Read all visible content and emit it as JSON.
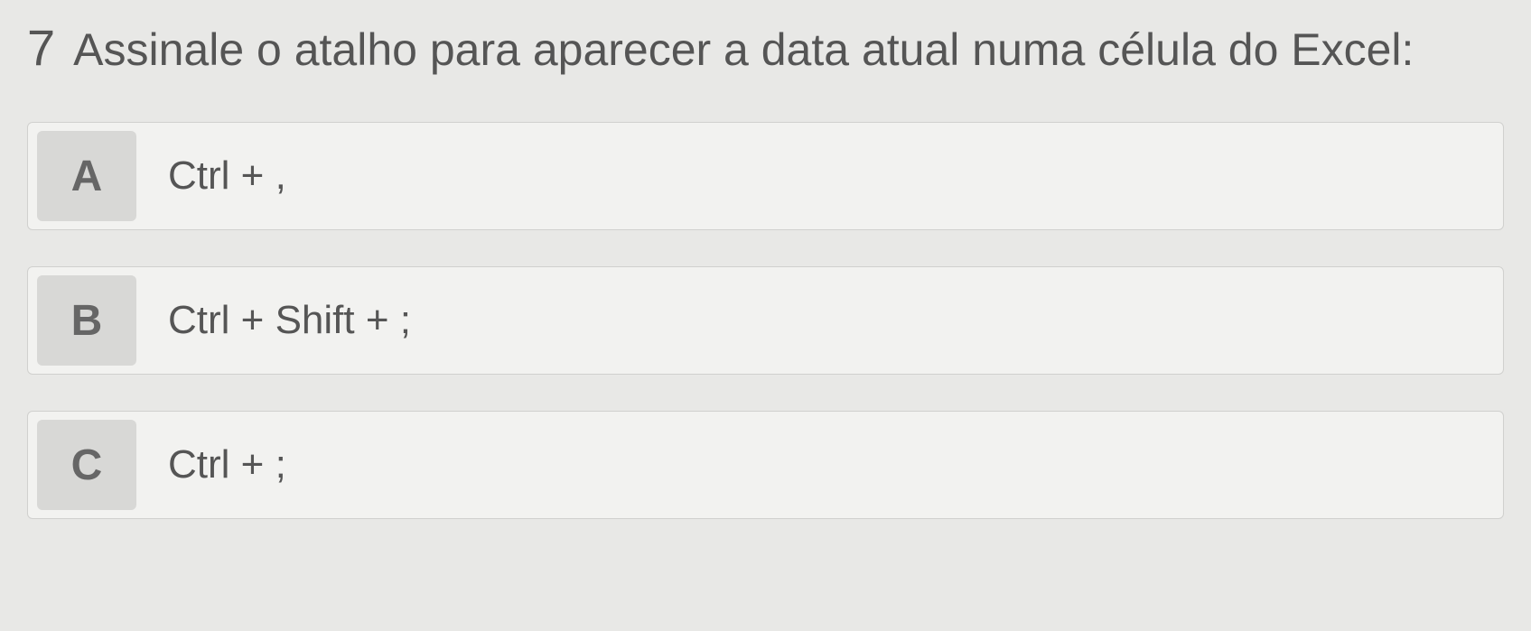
{
  "question": {
    "number": "7",
    "text": "Assinale o atalho para aparecer a data atual numa célula do Excel:"
  },
  "options": [
    {
      "letter": "A",
      "text": "Ctrl + ,"
    },
    {
      "letter": "B",
      "text": "Ctrl + Shift + ;"
    },
    {
      "letter": "C",
      "text": "Ctrl + ;"
    }
  ]
}
